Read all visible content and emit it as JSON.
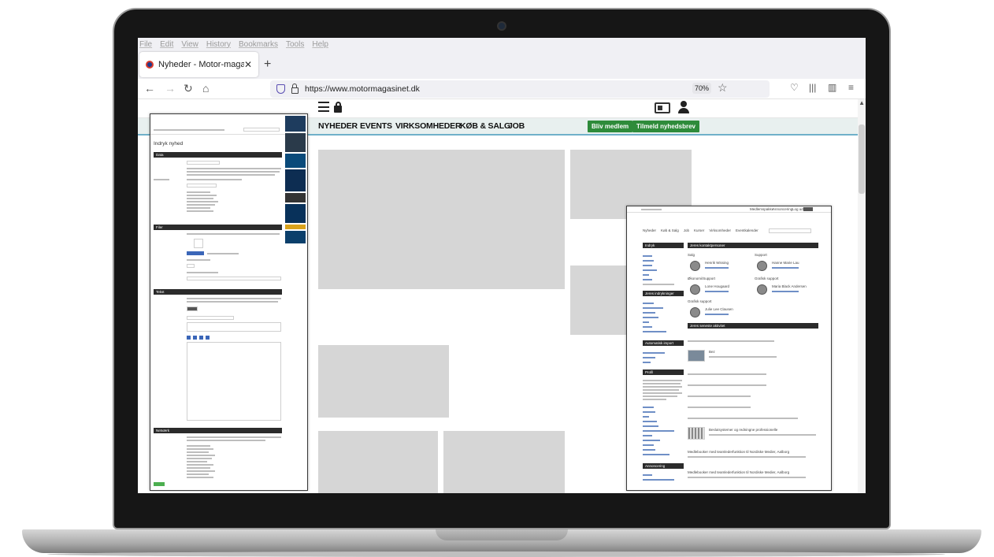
{
  "browser": {
    "menu": [
      "File",
      "Edit",
      "View",
      "History",
      "Bookmarks",
      "Tools",
      "Help"
    ],
    "tab_title": "Nyheder - Motor-magasinet",
    "tab_close": "✕",
    "new_tab": "+",
    "url": "https://www.motormagasinet.dk",
    "zoom": "70%"
  },
  "site": {
    "nav": [
      "NYHEDER",
      "EVENTS",
      "VIRKSOMHEDER",
      "KØB & SALG",
      "JOB"
    ],
    "btn_member": "Bliv medlem",
    "btn_newsletter": "Tilmeld nyhedsbrev"
  },
  "left_panel": {
    "title": "Indryk nyhed",
    "sections": [
      "Data",
      "Filer",
      "Tekst",
      "Netværk"
    ]
  },
  "right_panel": {
    "top_links": [
      "Medlemspakke",
      "Annoncering",
      "Log ud"
    ],
    "nav": [
      "Nyheder",
      "Køb & Salg",
      "Job",
      "Kurser",
      "Virksomheder",
      "Eventkalender"
    ],
    "sidebar_sections": [
      "Indryk",
      "Jeres indrykninger",
      "Automatisk import",
      "Profil",
      "Annoncering"
    ],
    "main_sections": [
      "Jeres kontaktpersoner",
      "Jeres seneste aktivitet"
    ],
    "contact_groups": [
      "Salg",
      "Support",
      "Økonomi/Support",
      "Grafisk support",
      "Grafisk support"
    ],
    "contacts": [
      "Henrik Wissing",
      "Hanne Marie Lau",
      "Lone Hougaard",
      "Maria Black Andersen",
      "Julie Lee Clausen"
    ],
    "activity": [
      "Bez",
      "Beslutsystemer og redningne professionelle",
      "Medlebooker med teamlederfunktion til Nordiske Medier, Aalborg",
      "Medlebooker med teamlederfunktion til Nordiske Medier, Aalborg"
    ]
  }
}
